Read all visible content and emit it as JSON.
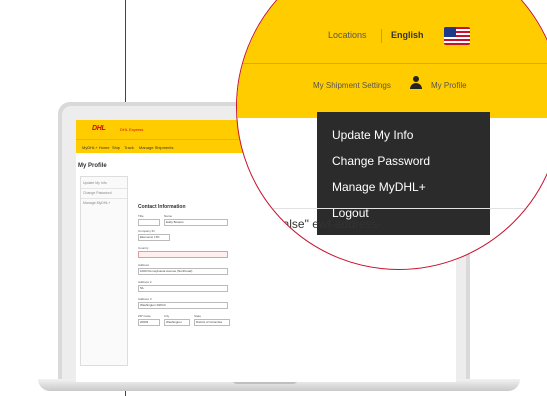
{
  "screen": {
    "logo_text": "DHL",
    "brand_text": "DHL Express",
    "nav": [
      "MyDHL+ Home",
      "Ship",
      "Track",
      "Manage Shipments"
    ],
    "page_title": "My Profile",
    "sidebar": [
      "Update My Info",
      "Change Password",
      "Manage MyDHL+"
    ],
    "section_title": "Contact Information",
    "fields": {
      "title_label": "Title",
      "name_label": "Name",
      "name_value": "Eddy Bowers",
      "company_label": "Company ID",
      "company_value": "Ekonomic LTD",
      "country_label": "Country",
      "address_label": "Address",
      "address_value": "1000 Pennsylvania Avenue (Northroad)",
      "address2_label": "Address 2",
      "address2_value": "5A",
      "address3_label": "Address 3",
      "address3_value": "Washington DWCC",
      "zip_label": "ZIP Code",
      "zip_value": "20004",
      "city_label": "City",
      "city_value": "Washington",
      "state_label": "State",
      "state_value": "District of Columbia"
    }
  },
  "magnifier": {
    "locations": "Locations",
    "language": "English",
    "shipment_settings": "My Shipment Settings",
    "my_profile": "My Profile",
    "dropdown": [
      "Update My Info",
      "Change Password",
      "Manage MyDHL+",
      "Logout"
    ],
    "code_fragment": "\"false\" ewf-address-"
  },
  "colors": {
    "dhl_yellow": "#ffcc00",
    "dhl_red": "#d40511",
    "menu_dark": "#2b2b2b"
  }
}
